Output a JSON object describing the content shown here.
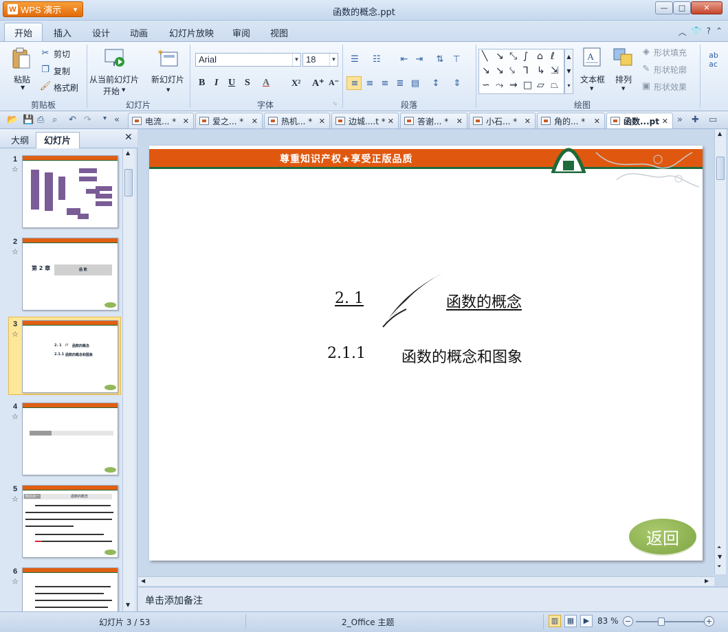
{
  "app": {
    "name": "WPS 演示",
    "window_title": "函数的概念.ppt"
  },
  "window_controls": {
    "minimize": "—",
    "maximize": "□",
    "close": "✕"
  },
  "ribbon_tabs": [
    "开始",
    "插入",
    "设计",
    "动画",
    "幻灯片放映",
    "审阅",
    "视图"
  ],
  "ribbon": {
    "clipboard": {
      "paste": "粘贴",
      "cut": "剪切",
      "copy": "复制",
      "format_painter": "格式刷",
      "label": "剪贴板"
    },
    "slides": {
      "from_current_line1": "从当前幻灯片",
      "from_current_line2": "开始",
      "new_slide": "新幻灯片",
      "label": "幻灯片"
    },
    "font": {
      "name": "Arial",
      "size": "18",
      "label": "字体",
      "bold": "B",
      "italic": "I",
      "underline": "U",
      "shadow": "S",
      "color": "A",
      "superscript": "X²",
      "grow": "A⁺",
      "shrink": "A⁻"
    },
    "paragraph": {
      "label": "段落"
    },
    "drawing": {
      "textbox": "文本框",
      "arrange": "排列",
      "shape_fill": "形状填充",
      "shape_outline": "形状轮廓",
      "shape_effect": "形状效果",
      "label": "绘图"
    }
  },
  "doc_tabs": [
    {
      "label": "电流... *",
      "active": false
    },
    {
      "label": "爱之... *",
      "active": false
    },
    {
      "label": "热机... *",
      "active": false
    },
    {
      "label": "边城....t *",
      "active": false
    },
    {
      "label": "答谢... *",
      "active": false
    },
    {
      "label": "小石... *",
      "active": false
    },
    {
      "label": "角的... *",
      "active": false
    },
    {
      "label": "函数...pt",
      "active": true
    }
  ],
  "left_panel": {
    "tab_outline": "大纲",
    "tab_slides": "幻灯片",
    "close": "✕",
    "slides": [
      {
        "num": "1",
        "star": "☆"
      },
      {
        "num": "2",
        "star": "☆",
        "chapter": "第 2 章",
        "title": "函 数"
      },
      {
        "num": "3",
        "star": "☆",
        "selected": true
      },
      {
        "num": "4",
        "star": "☆"
      },
      {
        "num": "5",
        "star": "☆",
        "tag": "知识点一",
        "title": "函数的概念"
      },
      {
        "num": "6",
        "star": "☆"
      }
    ]
  },
  "slide": {
    "banner": "尊重知识产权★享受正版品质",
    "heading_num": "2. 1",
    "heading_title": "函数的概念",
    "sub_num": "2.1.1",
    "sub_title": "函数的概念和图象",
    "return_label": "返回"
  },
  "notes_placeholder": "单击添加备注",
  "status": {
    "slide_counter": "幻灯片 3 / 53",
    "theme": "2_Office 主题",
    "zoom": "83 %"
  },
  "colors": {
    "accent_orange": "#e0580f",
    "banner_green": "#1e6a3c",
    "return_green": "#8db356"
  }
}
